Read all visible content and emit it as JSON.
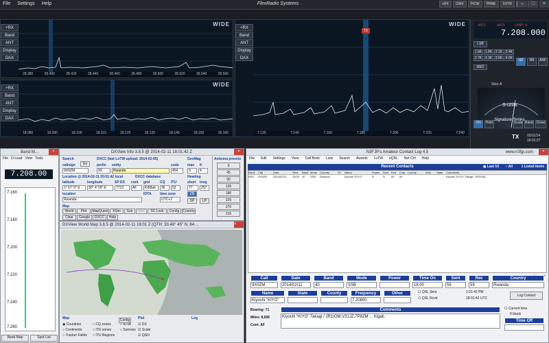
{
  "menu": [
    "File",
    "Settings",
    "Help"
  ],
  "brand": "FlexRadio Systems",
  "top_tabs": [
    "+RX",
    "CWX",
    "P/CW",
    "PHNE",
    "XVTR",
    "EQ",
    "TX"
  ],
  "pan_buttons": [
    "+RX",
    "Band",
    "ANT",
    "Display",
    "DAX"
  ],
  "pan_label": "WIDE",
  "pan_tl": {
    "ticks": [
      "28.380",
      "28.400",
      "28.420",
      "28.440",
      "28.460",
      "28.480",
      "28.500",
      "28.520",
      "28.540",
      "28.560"
    ]
  },
  "pan_bl": {
    "ticks": [
      "18.080",
      "18.090",
      "18.100",
      "18.110",
      "18.120",
      "18.130",
      "18.140",
      "18.150",
      "18.160"
    ]
  },
  "pan_right": {
    "ticks": [
      "7.120",
      "7.140",
      "7.160",
      "7.180",
      "7.200",
      "7.220",
      "7.240"
    ],
    "marker": "TX"
  },
  "radio": {
    "freq": "7.208.000",
    "mode": "LSB",
    "ant1": "ANT1",
    "ant2": "ANT1",
    "loop": "LOOP A",
    "loop2": "LOOP B",
    "filters": [
      "1.6K",
      "1.8K",
      "2.1K",
      "2.4K",
      "2.7K",
      "3.3K",
      "3.6K",
      "4.0K"
    ],
    "agc": "MED",
    "nr": "NR",
    "nb": "NB",
    "anf": "ANF",
    "slice": "Slice A",
    "smeter": "S-units",
    "series": "Signature Series",
    "tx": "TX",
    "on": "ON",
    "hold": "Hold",
    "scale": "Scale",
    "band": "Band",
    "close": "Close",
    "date": "02/11/14",
    "time": "18:01:27"
  },
  "bandmaster": {
    "title": "Band M...",
    "menu": [
      "File",
      "D-Lead",
      "View",
      "Tools",
      "Help"
    ],
    "freq": "7.208.00",
    "ticks": [
      "7.160",
      "7.180",
      "7.200",
      "7.220",
      "7.240",
      "7.260"
    ],
    "tabs": [
      "Band Map",
      "Spot List"
    ]
  },
  "dxinfo": {
    "title": "DXView Info 3.8.5 @ 2014-02-11  18:01:42 Z",
    "search_label": "Search",
    "callsign_label": "callsign",
    "callsign": "9X0ZM",
    "go": "Go",
    "dxcc_label": "DXCC  (last LoTW upload: 2014-02-05)",
    "prefix_label": "prefix",
    "entity_label": "entity",
    "code_label": "code",
    "prefix": "9X",
    "entity": "Rwanda",
    "code": "454",
    "geomag_label": "GeoMag",
    "max_label": "max",
    "k_label": "K",
    "max": "0",
    "k": "4",
    "location_label": "Location @ 2014-02-11 20:01:42 local",
    "dxcc_db": "DXCC database",
    "lat_label": "latitude",
    "lon_label": "longitude",
    "spdx_label": "SP DX",
    "cont_label": "cont",
    "grid_label": "grid",
    "cq_label": "CQ",
    "itu_label": "ITU",
    "lat": "1° 57' 0\" S",
    "lon": "30° 4' 59\" E",
    "spdx": "7712",
    "cont": "AF",
    "grid": "KI58ab",
    "cq": "36",
    "itu": "52",
    "heading_label": "Heading",
    "short_label": "short",
    "long_label": "long",
    "short": "77",
    "long": "257",
    "local_label": "location",
    "iota_label": "IOTA",
    "tz_label": "time zone",
    "local": "Rwanda",
    "tz": "UTC+2",
    "zb": "ZB",
    "sp": "SP",
    "lp": "LP",
    "map_label": "Map",
    "buttons": [
      "World",
      "Plot",
      "MapQuest",
      "XSim",
      "Sun",
      "GRC",
      "SC Lock",
      "Config",
      "Country",
      "Clear",
      "Google",
      "DXCC",
      "Help"
    ],
    "antenna_title": "Antenna presets",
    "presets": [
      "0",
      "45",
      "90",
      "135",
      "180",
      "225",
      "270",
      "315"
    ]
  },
  "worldmap": {
    "title": "DXView World Map 3.8.5 @ 2014-02-11  18:01 Z  (QTH: 33.48° 45\" N, 84 ...",
    "map_label": "Map",
    "plot_label": "Plot",
    "log_label": "Log",
    "opts1": [
      "Countries",
      "Continents",
      "Tracker Fields"
    ],
    "opts2": [
      "CQ zones",
      "ITU zones",
      "ITU Regions"
    ],
    "opts3": [
      "IOTA",
      "Surrows"
    ],
    "config": "Config",
    "dx": "DX",
    "scale": "Scale",
    "qso": "QSO"
  },
  "log": {
    "title": "N3FJP's Amateur Contact Log 4.5",
    "url": "www.n3fjp.com",
    "menu": [
      "File",
      "Edit",
      "Settings",
      "View",
      "Call Book",
      "Lists",
      "Search",
      "Awards",
      "LoTW",
      "eQSL",
      "Net Ctrl",
      "Help"
    ],
    "recent_title": "Recent Contacts",
    "last": "Last 10",
    "all": "All",
    "count": "1 Listed items",
    "cols": [
      "Recd",
      "Call",
      "Date",
      "Time",
      "Band",
      "Mode",
      "Country",
      "ST",
      "Name",
      "Power",
      "Sent",
      "Rcd",
      "Cnty",
      "County",
      "Grid",
      "State",
      "Comments"
    ],
    "row": [
      "0907",
      "9X0ZM",
      "2014/02/11",
      "18:00",
      "40",
      "SSB",
      "Rwanda",
      "",
      "Kiyoshi \"KIYO\"",
      "N",
      "N",
      "59",
      "59",
      "",
      "",
      "",
      "Kiyoshi \"KIYO\" Takagi / JR1IOM..."
    ],
    "labels": {
      "call": "Call",
      "date": "Date",
      "band": "Band",
      "mode": "Mode",
      "power": "Power",
      "time_on": "Time On",
      "sent": "Sent",
      "rec": "Rec",
      "country": "Country",
      "name": "Name",
      "state": "State",
      "county": "County",
      "frequency": "Frequency",
      "other": "Other",
      "comments": "Comments"
    },
    "values": {
      "call": "9X0ZM",
      "date": "2014/02/11",
      "band": "40",
      "mode": "SSB",
      "power": "",
      "time_on": "18:00",
      "sent": "59",
      "rec": "59",
      "country": "Rwanda",
      "name": "Kiyoshi \"KIYO\"",
      "state": "",
      "county": "",
      "frequency": "7.20800",
      "other": ""
    },
    "qsl_sent": "QSL Sent",
    "qsl_rcvd": "QSL Rcvd",
    "time1": "1:01:42 PM",
    "time2": "18:01:42 UTC",
    "log_contact": "Log Contact",
    "bearing": "Bearing: 71",
    "miles": "Miles: 8,006",
    "cont": "Cont: AF",
    "comment_text": "Kiyoshi \"KIYO\" Takagi / JR1IOM,V31JZ,7P8ZM ... Kigali,",
    "current_time": "Current time",
    "blank": "If blank",
    "time_off": "Time Off",
    "logging": "LogData.mdb"
  }
}
